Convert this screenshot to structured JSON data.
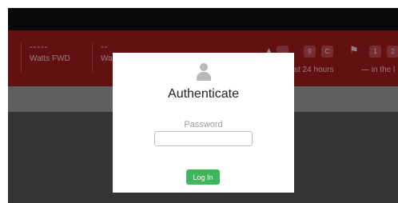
{
  "header": {
    "stats": [
      {
        "value": "-----",
        "label": "Watts FWD"
      },
      {
        "value": "--",
        "label": "Wa"
      }
    ],
    "alerts": {
      "badges": [
        "9",
        "C"
      ],
      "caption": "st 24 hours"
    },
    "flags": {
      "badges": [
        "1",
        "2"
      ],
      "caption": "— in the l"
    }
  },
  "auth_dialog": {
    "title": "Authenticate",
    "password_label": "Password",
    "password_value": "",
    "login_label": "Log In"
  }
}
